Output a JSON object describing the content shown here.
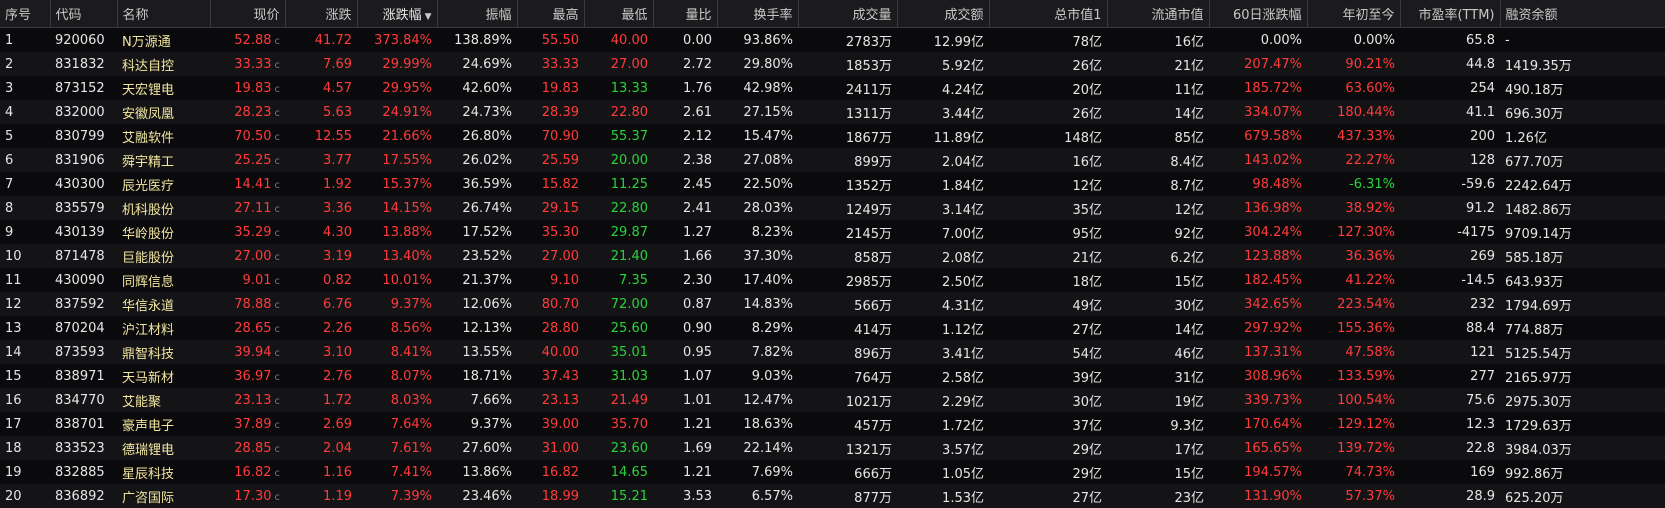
{
  "columns": [
    "序号",
    "代码",
    "名称",
    "现价",
    "涨跌",
    "涨跌幅",
    "振幅",
    "最高",
    "最低",
    "量比",
    "换手率",
    "成交量",
    "成交额",
    "总市值1",
    "流通市值",
    "60日涨跌幅",
    "年初至今",
    "市盈率(TTM)",
    "融资余额"
  ],
  "sort_indicator": "▼",
  "price_suffix": "c",
  "colors": {
    "up": "#ff3b3b",
    "down": "#2bd33b",
    "name": "#f2e6a0",
    "text": "#e6e6e6",
    "header_bg": "#1b1b1e"
  },
  "rows": [
    {
      "idx": "1",
      "code": "920060",
      "name": "N万源通",
      "price": "52.88",
      "chg": "41.72",
      "pct": "373.84%",
      "amp": "138.89%",
      "high": "55.50",
      "low": "40.00",
      "vr": "0.00",
      "turnover": "93.86%",
      "vol": "2783万",
      "amount": "12.99亿",
      "mcap": "78亿",
      "float": "16亿",
      "d60": "0.00%",
      "ytd": "0.00%",
      "pe": "65.8",
      "margin": "-"
    },
    {
      "idx": "2",
      "code": "831832",
      "name": "科达自控",
      "price": "33.33",
      "chg": "7.69",
      "pct": "29.99%",
      "amp": "24.69%",
      "high": "33.33",
      "low": "27.00",
      "vr": "2.72",
      "turnover": "29.80%",
      "vol": "1853万",
      "amount": "5.92亿",
      "mcap": "26亿",
      "float": "21亿",
      "d60": "207.47%",
      "ytd": "90.21%",
      "pe": "44.8",
      "margin": "1419.35万"
    },
    {
      "idx": "3",
      "code": "873152",
      "name": "天宏锂电",
      "price": "19.83",
      "chg": "4.57",
      "pct": "29.95%",
      "amp": "42.60%",
      "high": "19.83",
      "low": "13.33",
      "vr": "1.76",
      "turnover": "42.98%",
      "vol": "2411万",
      "amount": "4.24亿",
      "mcap": "20亿",
      "float": "11亿",
      "d60": "185.72%",
      "ytd": "63.60%",
      "pe": "254",
      "margin": "490.18万"
    },
    {
      "idx": "4",
      "code": "832000",
      "name": "安徽凤凰",
      "price": "28.23",
      "chg": "5.63",
      "pct": "24.91%",
      "amp": "24.73%",
      "high": "28.39",
      "low": "22.80",
      "vr": "2.61",
      "turnover": "27.15%",
      "vol": "1311万",
      "amount": "3.44亿",
      "mcap": "26亿",
      "float": "14亿",
      "d60": "334.07%",
      "ytd": "180.44%",
      "pe": "41.1",
      "margin": "696.30万"
    },
    {
      "idx": "5",
      "code": "830799",
      "name": "艾融软件",
      "price": "70.50",
      "chg": "12.55",
      "pct": "21.66%",
      "amp": "26.80%",
      "high": "70.90",
      "low": "55.37",
      "vr": "2.12",
      "turnover": "15.47%",
      "vol": "1867万",
      "amount": "11.89亿",
      "mcap": "148亿",
      "float": "85亿",
      "d60": "679.58%",
      "ytd": "437.33%",
      "pe": "200",
      "margin": "1.26亿"
    },
    {
      "idx": "6",
      "code": "831906",
      "name": "舜宇精工",
      "price": "25.25",
      "chg": "3.77",
      "pct": "17.55%",
      "amp": "26.02%",
      "high": "25.59",
      "low": "20.00",
      "vr": "2.38",
      "turnover": "27.08%",
      "vol": "899万",
      "amount": "2.04亿",
      "mcap": "16亿",
      "float": "8.4亿",
      "d60": "143.02%",
      "ytd": "22.27%",
      "pe": "128",
      "margin": "677.70万"
    },
    {
      "idx": "7",
      "code": "430300",
      "name": "辰光医疗",
      "price": "14.41",
      "chg": "1.92",
      "pct": "15.37%",
      "amp": "36.59%",
      "high": "15.82",
      "low": "11.25",
      "vr": "2.45",
      "turnover": "22.50%",
      "vol": "1352万",
      "amount": "1.84亿",
      "mcap": "12亿",
      "float": "8.7亿",
      "d60": "98.48%",
      "ytd": "-6.31%",
      "pe": "-59.6",
      "margin": "2242.64万"
    },
    {
      "idx": "8",
      "code": "835579",
      "name": "机科股份",
      "price": "27.11",
      "chg": "3.36",
      "pct": "14.15%",
      "amp": "26.74%",
      "high": "29.15",
      "low": "22.80",
      "vr": "2.41",
      "turnover": "28.03%",
      "vol": "1249万",
      "amount": "3.14亿",
      "mcap": "35亿",
      "float": "12亿",
      "d60": "136.98%",
      "ytd": "38.92%",
      "pe": "91.2",
      "margin": "1482.86万"
    },
    {
      "idx": "9",
      "code": "430139",
      "name": "华岭股份",
      "price": "35.29",
      "chg": "4.30",
      "pct": "13.88%",
      "amp": "17.52%",
      "high": "35.30",
      "low": "29.87",
      "vr": "1.27",
      "turnover": "8.23%",
      "vol": "2145万",
      "amount": "7.00亿",
      "mcap": "95亿",
      "float": "92亿",
      "d60": "304.24%",
      "ytd": "127.30%",
      "pe": "-4175",
      "margin": "9709.14万"
    },
    {
      "idx": "10",
      "code": "871478",
      "name": "巨能股份",
      "price": "27.00",
      "chg": "3.19",
      "pct": "13.40%",
      "amp": "23.52%",
      "high": "27.00",
      "low": "21.40",
      "vr": "1.66",
      "turnover": "37.30%",
      "vol": "858万",
      "amount": "2.08亿",
      "mcap": "21亿",
      "float": "6.2亿",
      "d60": "123.88%",
      "ytd": "36.36%",
      "pe": "269",
      "margin": "585.18万"
    },
    {
      "idx": "11",
      "code": "430090",
      "name": "同辉信息",
      "price": "9.01",
      "chg": "0.82",
      "pct": "10.01%",
      "amp": "21.37%",
      "high": "9.10",
      "low": "7.35",
      "vr": "2.30",
      "turnover": "17.40%",
      "vol": "2985万",
      "amount": "2.50亿",
      "mcap": "18亿",
      "float": "15亿",
      "d60": "182.45%",
      "ytd": "41.22%",
      "pe": "-14.5",
      "margin": "643.93万"
    },
    {
      "idx": "12",
      "code": "837592",
      "name": "华信永道",
      "price": "78.88",
      "chg": "6.76",
      "pct": "9.37%",
      "amp": "12.06%",
      "high": "80.70",
      "low": "72.00",
      "vr": "0.87",
      "turnover": "14.83%",
      "vol": "566万",
      "amount": "4.31亿",
      "mcap": "49亿",
      "float": "30亿",
      "d60": "342.65%",
      "ytd": "223.54%",
      "pe": "232",
      "margin": "1794.69万"
    },
    {
      "idx": "13",
      "code": "870204",
      "name": "沪江材料",
      "price": "28.65",
      "chg": "2.26",
      "pct": "8.56%",
      "amp": "12.13%",
      "high": "28.80",
      "low": "25.60",
      "vr": "0.90",
      "turnover": "8.29%",
      "vol": "414万",
      "amount": "1.12亿",
      "mcap": "27亿",
      "float": "14亿",
      "d60": "297.92%",
      "ytd": "155.36%",
      "pe": "88.4",
      "margin": "774.88万"
    },
    {
      "idx": "14",
      "code": "873593",
      "name": "鼎智科技",
      "price": "39.94",
      "chg": "3.10",
      "pct": "8.41%",
      "amp": "13.55%",
      "high": "40.00",
      "low": "35.01",
      "vr": "0.95",
      "turnover": "7.82%",
      "vol": "896万",
      "amount": "3.41亿",
      "mcap": "54亿",
      "float": "46亿",
      "d60": "137.31%",
      "ytd": "47.58%",
      "pe": "121",
      "margin": "5125.54万"
    },
    {
      "idx": "15",
      "code": "838971",
      "name": "天马新材",
      "price": "36.97",
      "chg": "2.76",
      "pct": "8.07%",
      "amp": "18.71%",
      "high": "37.43",
      "low": "31.03",
      "vr": "1.07",
      "turnover": "9.03%",
      "vol": "764万",
      "amount": "2.58亿",
      "mcap": "39亿",
      "float": "31亿",
      "d60": "308.96%",
      "ytd": "133.59%",
      "pe": "277",
      "margin": "2165.97万"
    },
    {
      "idx": "16",
      "code": "834770",
      "name": "艾能聚",
      "price": "23.13",
      "chg": "1.72",
      "pct": "8.03%",
      "amp": "7.66%",
      "high": "23.13",
      "low": "21.49",
      "vr": "1.01",
      "turnover": "12.47%",
      "vol": "1021万",
      "amount": "2.29亿",
      "mcap": "30亿",
      "float": "19亿",
      "d60": "339.73%",
      "ytd": "100.54%",
      "pe": "75.6",
      "margin": "2975.30万"
    },
    {
      "idx": "17",
      "code": "838701",
      "name": "豪声电子",
      "price": "37.89",
      "chg": "2.69",
      "pct": "7.64%",
      "amp": "9.37%",
      "high": "39.00",
      "low": "35.70",
      "vr": "1.21",
      "turnover": "18.63%",
      "vol": "457万",
      "amount": "1.72亿",
      "mcap": "37亿",
      "float": "9.3亿",
      "d60": "170.64%",
      "ytd": "129.12%",
      "pe": "12.3",
      "margin": "1729.63万"
    },
    {
      "idx": "18",
      "code": "833523",
      "name": "德瑞锂电",
      "price": "28.85",
      "chg": "2.04",
      "pct": "7.61%",
      "amp": "27.60%",
      "high": "31.00",
      "low": "23.60",
      "vr": "1.69",
      "turnover": "22.14%",
      "vol": "1321万",
      "amount": "3.57亿",
      "mcap": "29亿",
      "float": "17亿",
      "d60": "165.65%",
      "ytd": "139.72%",
      "pe": "22.8",
      "margin": "3984.03万"
    },
    {
      "idx": "19",
      "code": "832885",
      "name": "星辰科技",
      "price": "16.82",
      "chg": "1.16",
      "pct": "7.41%",
      "amp": "13.86%",
      "high": "16.82",
      "low": "14.65",
      "vr": "1.21",
      "turnover": "7.69%",
      "vol": "666万",
      "amount": "1.05亿",
      "mcap": "29亿",
      "float": "15亿",
      "d60": "194.57%",
      "ytd": "74.73%",
      "pe": "169",
      "margin": "992.86万"
    },
    {
      "idx": "20",
      "code": "836892",
      "name": "广咨国际",
      "price": "17.30",
      "chg": "1.19",
      "pct": "7.39%",
      "amp": "23.46%",
      "high": "18.99",
      "low": "15.21",
      "vr": "3.53",
      "turnover": "6.57%",
      "vol": "877万",
      "amount": "1.53亿",
      "mcap": "27亿",
      "float": "23亿",
      "d60": "131.90%",
      "ytd": "57.37%",
      "pe": "28.9",
      "margin": "625.20万"
    }
  ]
}
